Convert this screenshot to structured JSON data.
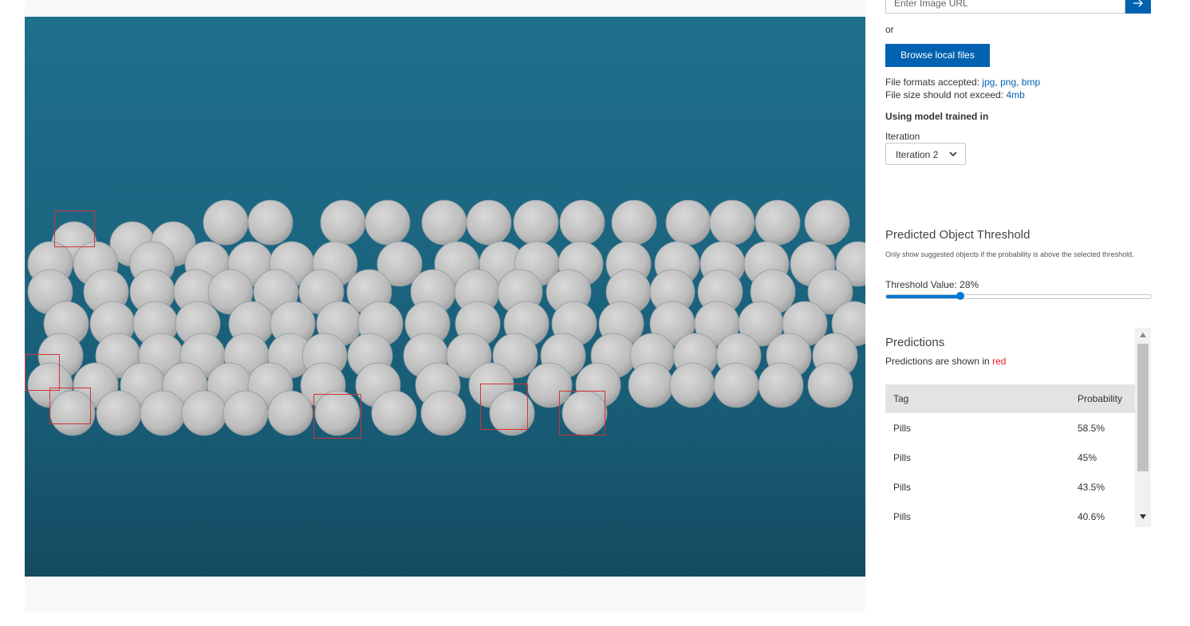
{
  "url_input": {
    "placeholder": "Enter Image URL",
    "button_icon": "arrow-right-icon"
  },
  "or_text": "or",
  "browse_button": "Browse local files",
  "file_formats": {
    "label": "File formats accepted:",
    "values": [
      "jpg",
      "png",
      "bmp"
    ]
  },
  "file_size": {
    "label": "File size should not exceed:",
    "value": "4mb"
  },
  "model_label": "Using model trained in",
  "iteration": {
    "label": "Iteration",
    "selected": "Iteration 2"
  },
  "threshold": {
    "title": "Predicted Object Threshold",
    "description": "Only show suggested objects if the probability is above the selected threshold.",
    "value_label": "Threshold Value: 28%",
    "value_percent": 28
  },
  "predictions": {
    "title": "Predictions",
    "subtitle_prefix": "Predictions are shown in",
    "subtitle_color_word": "red",
    "columns": [
      "Tag",
      "Probability"
    ],
    "rows": [
      {
        "tag": "Pills",
        "probability": "58.5%"
      },
      {
        "tag": "Pills",
        "probability": "45%"
      },
      {
        "tag": "Pills",
        "probability": "43.5%"
      },
      {
        "tag": "Pills",
        "probability": "40.6%"
      }
    ]
  },
  "colors": {
    "accent": "#0062b1",
    "slider": "#0078d4",
    "prediction_box": "#d13438",
    "background_image": "#1b647f"
  }
}
